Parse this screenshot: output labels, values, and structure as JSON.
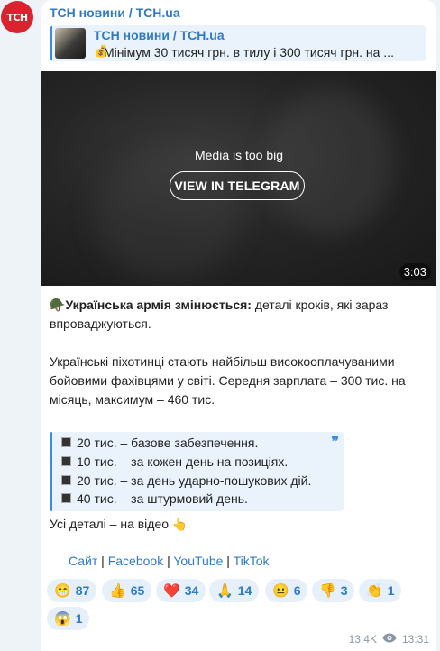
{
  "avatar": {
    "label": "ТСН"
  },
  "post": {
    "channel": "ТСН новини / TCH.ua",
    "reply": {
      "name": "ТСН новини / TCH.ua",
      "icon": "💰",
      "text": "Мінімум 30 тисяч грн. в тилу і 300 тисяч грн. на ..."
    },
    "media": {
      "message": "Media is too big",
      "button": "VIEW IN TELEGRAM",
      "duration": "3:03"
    },
    "headline_icon": "🪖",
    "headline_bold": "Українська армія змінюється:",
    "headline_rest": " деталі кроків, які зараз впроваджуються.",
    "paragraph": "Українські піхотинці стають найбільш високооплачуваними бойовими фахівцями у світі. Середня зарплата – 300 тис. на місяць, максимум – 460 тис.",
    "quote_lines": [
      "20 тис. – базове забезпечення.",
      "10 тис. – за кожен день на позиціях.",
      "20 тис. – за день ударно-пошукових дій.",
      "40 тис. – за штурмовий день."
    ],
    "details": "Усі деталі – на відео 👆",
    "links": [
      "Сайт",
      "Facebook",
      "YouTube",
      "TikTok"
    ],
    "reactions": [
      {
        "emoji": "😁",
        "count": "87"
      },
      {
        "emoji": "👍",
        "count": "65"
      },
      {
        "emoji": "❤️",
        "count": "34"
      },
      {
        "emoji": "🙏",
        "count": "14"
      },
      {
        "emoji": "😐",
        "count": "6"
      },
      {
        "emoji": "👎",
        "count": "3"
      },
      {
        "emoji": "👏",
        "count": "1"
      },
      {
        "emoji": "😱",
        "count": "1"
      }
    ],
    "views": "13.4K",
    "time": "13:31"
  }
}
